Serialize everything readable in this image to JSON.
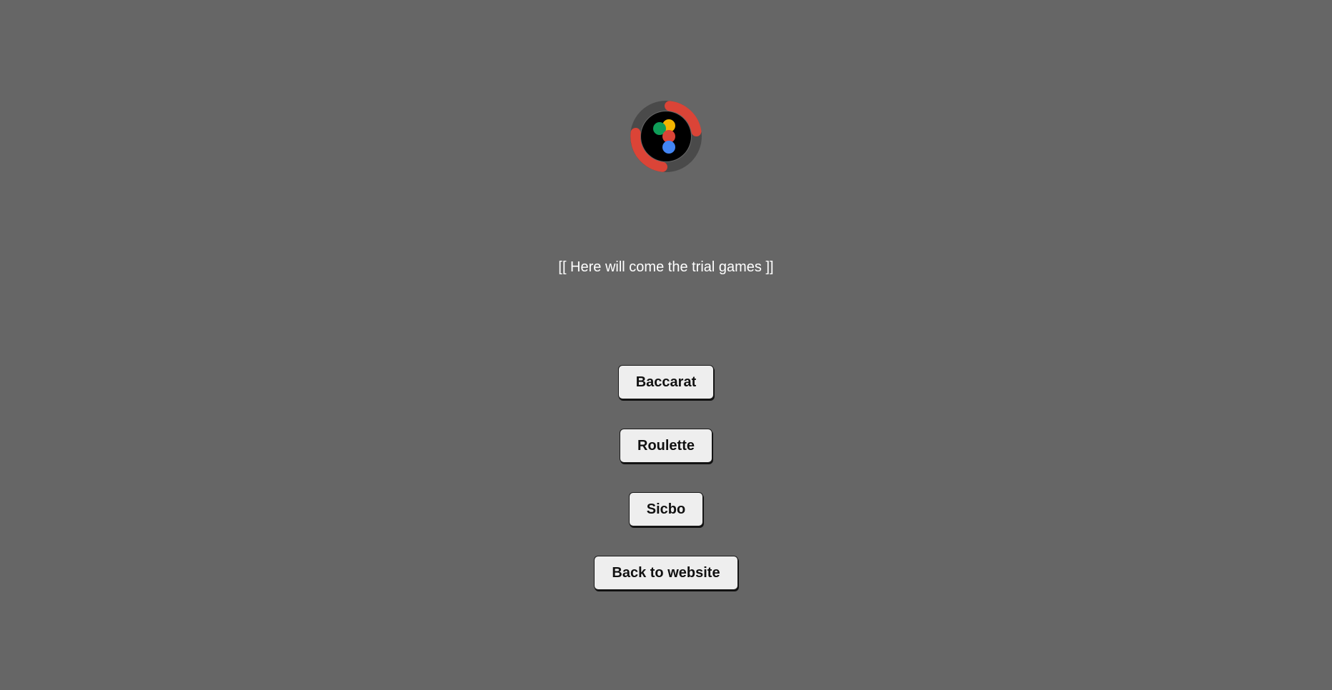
{
  "logo": {
    "icon": "roulette-logo-icon",
    "colors": {
      "ring_dark": "#4a4a4a",
      "ring_red": "#db4437",
      "center": "#000000",
      "green": "#0f9d58",
      "yellow": "#f4b400",
      "red": "#db4437",
      "blue": "#4285f4"
    }
  },
  "main": {
    "placeholder_text": "[[ Here will come the trial games ]]"
  },
  "menu": {
    "baccarat_label": "Baccarat",
    "roulette_label": "Roulette",
    "sicbo_label": "Sicbo",
    "back_label": "Back to website"
  }
}
